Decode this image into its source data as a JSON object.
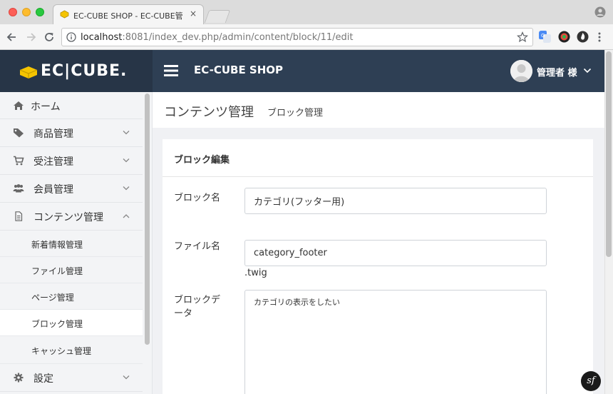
{
  "browser": {
    "tab_title": "EC-CUBE SHOP - EC-CUBE管",
    "tab_close": "×",
    "url_host": "localhost",
    "url_path": ":8081/index_dev.php/admin/content/block/11/edit"
  },
  "header": {
    "logo_text": "EC|CUBE.",
    "shop_name": "EC-CUBE SHOP",
    "user_name": "管理者 様"
  },
  "sidebar": {
    "items": [
      {
        "label": "ホーム",
        "icon": "home-icon"
      },
      {
        "label": "商品管理",
        "icon": "tag-icon"
      },
      {
        "label": "受注管理",
        "icon": "cart-icon"
      },
      {
        "label": "会員管理",
        "icon": "users-icon"
      },
      {
        "label": "コンテンツ管理",
        "icon": "file-icon"
      }
    ],
    "sub_items": [
      {
        "label": "新着情報管理"
      },
      {
        "label": "ファイル管理"
      },
      {
        "label": "ページ管理"
      },
      {
        "label": "ブロック管理"
      },
      {
        "label": "キャッシュ管理"
      }
    ],
    "settings": {
      "label": "設定",
      "icon": "gear-icon"
    }
  },
  "main": {
    "title": "コンテンツ管理",
    "subtitle": "ブロック管理",
    "card_title": "ブロック編集",
    "fields": {
      "block_name_label": "ブロック名",
      "block_name_value": "カテゴリ(フッター用)",
      "file_name_label": "ファイル名",
      "file_name_value": "category_footer",
      "file_suffix": ".twig",
      "block_data_label": "ブロックデータ",
      "block_data_value": "カテゴリの表示をしたい"
    }
  },
  "badge": {
    "text": "sf"
  },
  "colors": {
    "header_bg": "#2e3f54",
    "logo_bg": "#273547",
    "logo_yellow": "#f5c400"
  }
}
